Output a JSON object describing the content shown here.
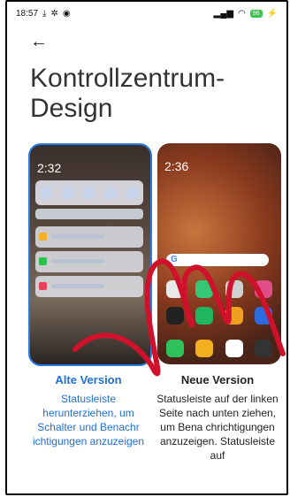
{
  "status_bar": {
    "time": "18:57",
    "battery": "96"
  },
  "header": {
    "back_label": "←",
    "title": "Kontrollzentrum-Design"
  },
  "options": [
    {
      "id": "old",
      "preview_time": "2:32",
      "name": "Alte Version",
      "selected": true,
      "description": "Statusleiste herunterziehen, um Schalter und Benachr ichtigungen anzuzeigen"
    },
    {
      "id": "new",
      "preview_time": "2:36",
      "name": "Neue Version",
      "selected": false,
      "description": "Statusleiste auf der linken Seite nach unten ziehen, um Bena chrichtigungen anzuzeigen. Statusleiste auf"
    }
  ],
  "colors": {
    "accent": "#1f6fd8",
    "swipe_gesture": "#d0112b"
  }
}
